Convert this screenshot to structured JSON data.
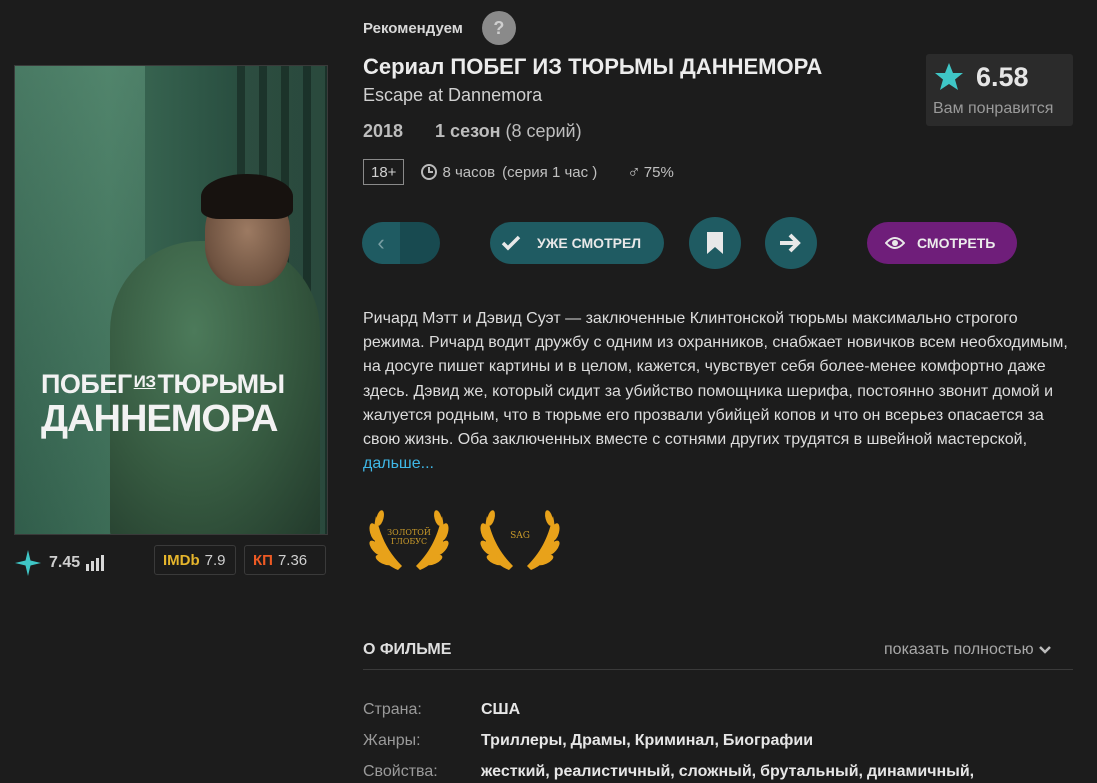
{
  "header": {
    "recommend_label": "Рекомендуем",
    "help_glyph": "?"
  },
  "poster": {
    "line1_a": "ПОБЕГ",
    "line1_small": "ИЗ",
    "line1_b": "ТЮРЬМЫ",
    "line2": "ДАННЕМОРА"
  },
  "movie": {
    "title": "Сериал ПОБЕГ ИЗ ТЮРЬМЫ ДАННЕМОРА",
    "original_title": "Escape at Dannemora",
    "year": "2018",
    "seasons": "1 сезон",
    "episodes": "(8 серий)",
    "age_rating": "18+",
    "duration": "8 часов",
    "episode_duration": "(серия 1 час )",
    "male_symbol": "♂",
    "male_percent": "75%"
  },
  "score": {
    "value": "6.58",
    "label": "Вам понравится",
    "accent": "#3fc6c6"
  },
  "ratings": {
    "own_value": "7.45",
    "imdb_label": "IMDb",
    "imdb_value": "7.9",
    "kp_label": "КП",
    "kp_value": "7.36"
  },
  "buttons": {
    "back_icon": "chevron-left-icon",
    "watched_label": "УЖЕ СМОТРЕЛ",
    "watch_label": "СМОТРЕТЬ"
  },
  "description": {
    "text": "Ричард Мэтт и Дэвид Суэт — заключенные Клинтонской тюрьмы максимально строгого режима. Ричард водит дружбу с одним из охранников, снабжает новичков всем необходимым, на досуге пишет картины и в целом, кажется, чувствует себя более-менее комфортно даже здесь. Дэвид же, который сидит за убийство помощника шерифа, постоянно звонит домой и жалуется родным, что в тюрьме его прозвали убийцей копов и что он всерьез опасается за свою жизнь. Оба заключенных вместе с сотнями других трудятся в швейной мастерской,",
    "more_link": "дальше..."
  },
  "awards": [
    {
      "line1": "ЗОЛОТОЙ",
      "line2": "ГЛОБУС"
    },
    {
      "line1": "SAG",
      "line2": ""
    }
  ],
  "about": {
    "heading": "О ФИЛЬМЕ",
    "show_all": "показать полностью",
    "country_label": "Страна:",
    "country": "США",
    "genres_label": "Жанры:",
    "genres": [
      "Триллеры,",
      "Драмы,",
      "Криминал,",
      "Биографии"
    ],
    "props_label": "Свойства:",
    "props": [
      "жесткий,",
      "реалистичный,",
      "сложный,",
      "брутальный,",
      "динамичный,"
    ]
  },
  "colors": {
    "background": "#1c1c1c",
    "teal_button": "#1f5b62",
    "watch_button": "#6f1e7a",
    "link": "#3fb7e6",
    "award_gold": "#e8a21a"
  }
}
